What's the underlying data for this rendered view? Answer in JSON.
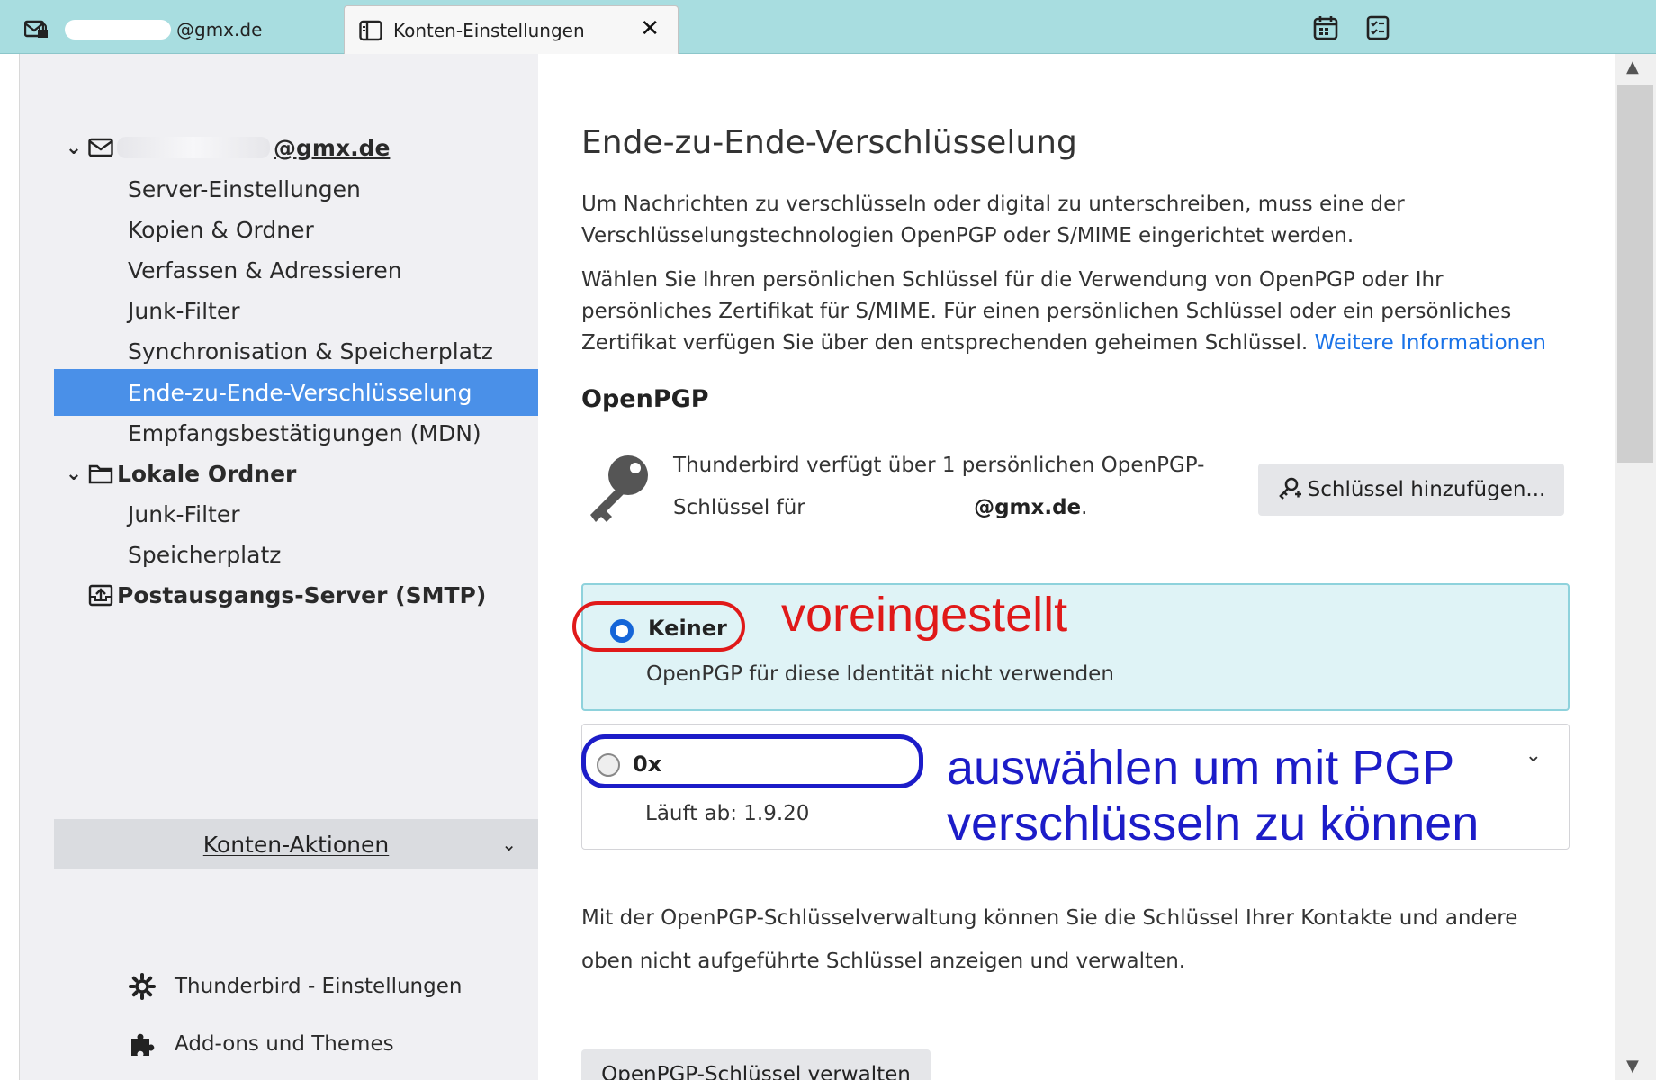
{
  "tabs": [
    {
      "label": "@gmx.de",
      "icon": "mail-lock-icon"
    },
    {
      "label": "Konten-Einstellungen",
      "icon": "settings-page-icon",
      "close": "✕"
    }
  ],
  "toolbar_icons": [
    "calendar-icon",
    "tasks-icon"
  ],
  "sidebar": {
    "account1": {
      "label": "@gmx.de",
      "icon": "mail-icon",
      "twisty": "⌄"
    },
    "account1_items": [
      "Server-Einstellungen",
      "Kopien & Ordner",
      "Verfassen & Adressieren",
      "Junk-Filter",
      "Synchronisation & Speicherplatz",
      "Ende-zu-Ende-Verschlüsselung",
      "Empfangsbestätigungen (MDN)"
    ],
    "local": {
      "label": "Lokale Ordner",
      "icon": "folder-icon",
      "twisty": "⌄"
    },
    "local_items": [
      "Junk-Filter",
      "Speicherplatz"
    ],
    "smtp": {
      "label": "Postausgangs-Server (SMTP)",
      "icon": "outbox-icon"
    },
    "account_actions": "Konten-Aktionen",
    "footer": [
      {
        "label": "Thunderbird - Einstellungen",
        "icon": "gear-icon"
      },
      {
        "label": "Add-ons und Themes",
        "icon": "puzzle-icon"
      }
    ]
  },
  "main": {
    "heading": "Ende-zu-Ende-Verschlüsselung",
    "para1": "Um Nachrichten zu verschlüsseln oder digital zu unterschreiben, muss eine der Verschlüsselungstechnologien OpenPGP oder S/MIME eingerichtet werden.",
    "para2": "Wählen Sie Ihren persönlichen Schlüssel für die Verwendung von OpenPGP oder Ihr persönliches Zertifikat für S/MIME. Für einen persönlichen Schlüssel oder ein persönliches Zertifikat verfügen Sie über den entsprechenden geheimen Schlüssel.",
    "more_info_link": "Weitere Informationen",
    "openpgp_heading": "OpenPGP",
    "key_text_1": "Thunderbird verfügt über 1 persönlichen OpenPGP-Schlüssel für",
    "key_text_email": "@gmx.de",
    "add_key_button": "Schlüssel hinzufügen...",
    "option_none_label": "Keiner",
    "option_none_desc": "OpenPGP für diese Identität nicht verwenden",
    "option_key_label": "0x",
    "option_key_expiry": "Läuft ab: 1",
    "option_key_expiry_suffix": ".9.20",
    "manage_text": "Mit der OpenPGP-Schlüsselverwaltung können Sie die Schlüssel Ihrer Kontakte und andere oben nicht aufgeführte Schlüssel anzeigen und verwalten.",
    "manage_button": "OpenPGP-Schlüssel verwalten"
  },
  "annotations": {
    "red": "voreingestellt",
    "blue": "auswählen um mit PGP verschlüsseln zu können"
  },
  "colors": {
    "tabbar": "#a8dde0",
    "selected": "#4a90e8",
    "link": "#1a73e8",
    "annot_red": "#e01919",
    "annot_blue": "#1c1cc8",
    "radio_selected_bg": "#dff3f6"
  }
}
